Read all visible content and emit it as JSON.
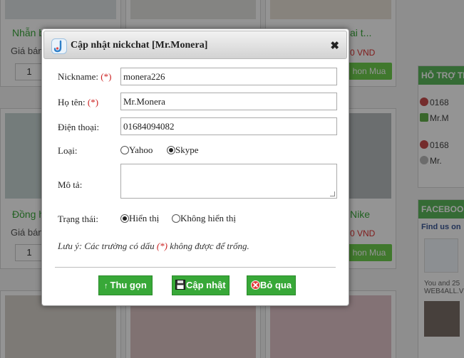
{
  "background": {
    "products": [
      {
        "name": "Nhẫn b",
        "price_label": "Giá bán",
        "qty": "1",
        "right_price": "",
        "buy": ""
      },
      {
        "name": "",
        "price_label": "",
        "qty": "",
        "right_price": "",
        "buy": ""
      },
      {
        "name": "ai t...",
        "price_label": "",
        "qty": "",
        "right_price": "0 VND",
        "buy": "hon Mua"
      },
      {
        "name": "Đồng h",
        "price_label": "Giá bán",
        "qty": "1",
        "right_price": "",
        "buy": ""
      },
      {
        "name": "",
        "price_label": "",
        "qty": "",
        "right_price": "",
        "buy": ""
      },
      {
        "name": "Nike",
        "price_label": "",
        "qty": "",
        "right_price": "0 VND",
        "buy": "hon Mua"
      }
    ],
    "sidebar": {
      "support_title": "HỖ TRỢ TR",
      "support_rows": [
        "0168",
        "Mr.M",
        "0168",
        "Mr."
      ],
      "facebook_title": "FACEBOOK",
      "find_us": "Find us on",
      "fans_text": [
        "You and 25",
        "WEB4ALL.V"
      ]
    }
  },
  "dialog": {
    "title": "Cập nhật nickchat [Mr.Monera]",
    "close": "✖",
    "required_mark": "(*)",
    "fields": {
      "nickname": {
        "label": "Nickname:",
        "value": "monera226"
      },
      "fullname": {
        "label": "Họ tên:",
        "value": "Mr.Monera"
      },
      "phone": {
        "label": "Điện thoại:",
        "value": "01684094082"
      },
      "type": {
        "label": "Loại:",
        "options": [
          "Yahoo",
          "Skype"
        ],
        "selected": "Skype"
      },
      "description": {
        "label": "Mô tả:",
        "value": ""
      },
      "status": {
        "label": "Trạng thái:",
        "options": [
          "Hiển thị",
          "Không hiển thị"
        ],
        "selected": "Hiển thị"
      }
    },
    "note": {
      "prefix": "Lưu ý: Các trường có dấu ",
      "mark": "(*)",
      "suffix": " không được để trống."
    },
    "buttons": {
      "collapse": "Thu gọn",
      "update": "Cập nhật",
      "cancel": "Bỏ qua"
    },
    "colors": {
      "button_green": "#38a838",
      "required_red": "#cc2222"
    }
  }
}
